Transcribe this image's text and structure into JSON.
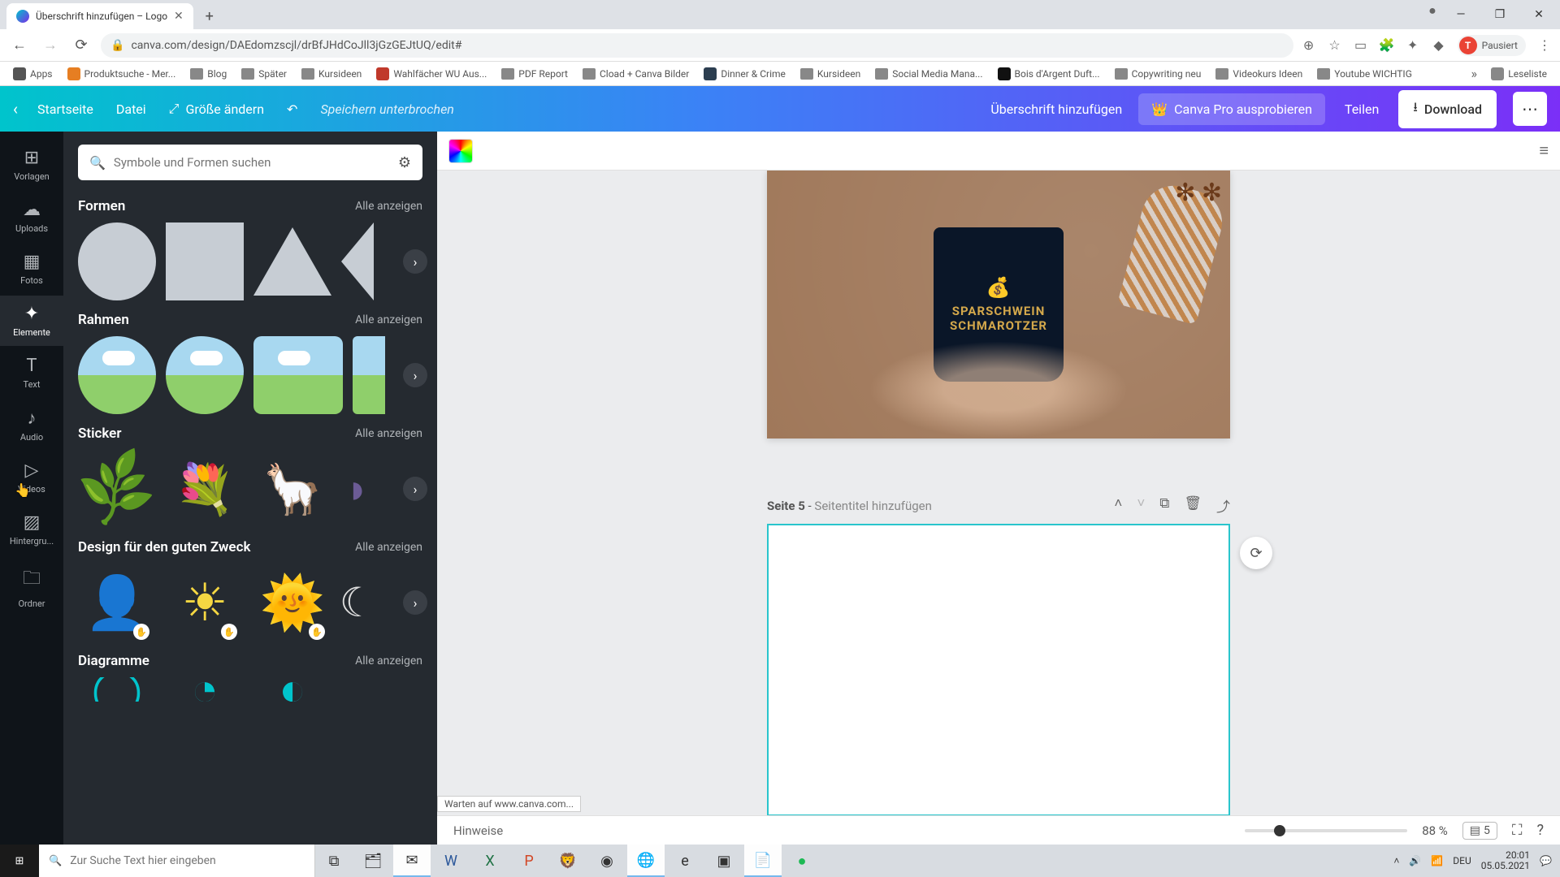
{
  "browser": {
    "tab_title": "Überschrift hinzufügen – Logo",
    "url": "canva.com/design/DAEdomzscjl/drBfJHdCoJll3jGzGEJtUQ/edit#",
    "profile_label": "Pausiert",
    "profile_initial": "T",
    "win": {
      "min": "—",
      "max": "❐",
      "close": "✕"
    }
  },
  "bookmarks": [
    "Apps",
    "Produktsuche - Mer...",
    "Blog",
    "Später",
    "Kursideen",
    "Wahlfächer WU Aus...",
    "PDF Report",
    "Cload + Canva Bilder",
    "Dinner & Crime",
    "Kursideen",
    "Social Media Mana...",
    "Bois d'Argent Duft...",
    "Copywriting neu",
    "Videokurs Ideen",
    "Youtube WICHTIG"
  ],
  "bookmarks_overflow": "Leseliste",
  "header": {
    "back": "‹",
    "home": "Startseite",
    "file": "Datei",
    "resize": "Größe ändern",
    "undo": "↶",
    "save_status": "Speichern unterbrochen",
    "doc_title": "Überschrift hinzufügen",
    "pro": "Canva Pro ausprobieren",
    "share": "Teilen",
    "download": "Download",
    "more": "⋯"
  },
  "rail": [
    {
      "key": "vorlagen",
      "label": "Vorlagen",
      "icon": "⊞"
    },
    {
      "key": "uploads",
      "label": "Uploads",
      "icon": "☁"
    },
    {
      "key": "fotos",
      "label": "Fotos",
      "icon": "▦"
    },
    {
      "key": "elemente",
      "label": "Elemente",
      "icon": "✦"
    },
    {
      "key": "text",
      "label": "Text",
      "icon": "T"
    },
    {
      "key": "audio",
      "label": "Audio",
      "icon": "♪"
    },
    {
      "key": "videos",
      "label": "Videos",
      "icon": "▷"
    },
    {
      "key": "hintergrund",
      "label": "Hintergru...",
      "icon": "▨"
    },
    {
      "key": "ordner",
      "label": "Ordner",
      "icon": "🗀"
    }
  ],
  "rail_active": "elemente",
  "panel": {
    "search_placeholder": "Symbole und Formen suchen",
    "see_all": "Alle anzeigen",
    "sections": {
      "formen": "Formen",
      "rahmen": "Rahmen",
      "sticker": "Sticker",
      "charity": "Design für den guten Zweck",
      "diagramme": "Diagramme"
    }
  },
  "canvas": {
    "mug_line1": "SPARSCHWEIN",
    "mug_line2": "SCHMAROTZER",
    "page_label": "Seite 5",
    "page_sep": " - ",
    "page_title_placeholder": "Seitentitel hinzufügen"
  },
  "bottom": {
    "hinweise": "Hinweise",
    "zoom": "88 %",
    "page_total": "5",
    "status_tip": "Warten auf www.canva.com..."
  },
  "taskbar": {
    "search_placeholder": "Zur Suche Text hier eingeben",
    "lang": "DEU",
    "time": "20:01",
    "date": "05.05.2021"
  }
}
